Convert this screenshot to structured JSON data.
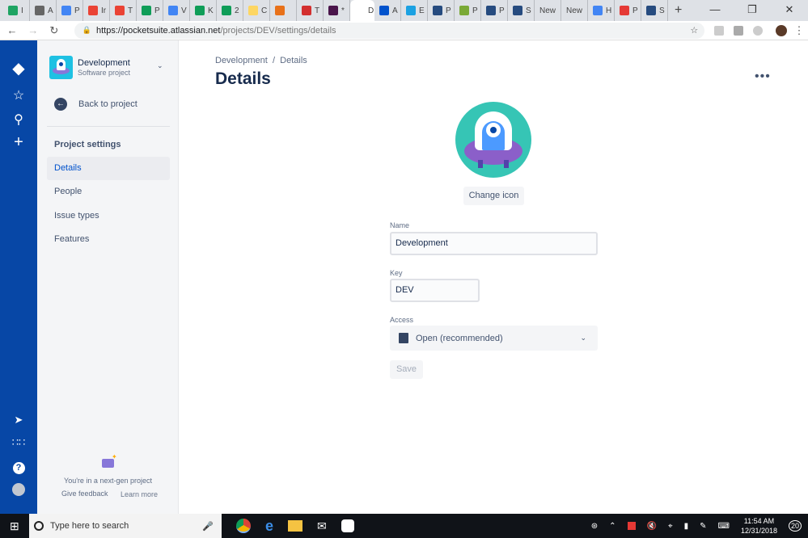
{
  "browser": {
    "tabs": [
      {
        "label": "I",
        "color": "#1fa463"
      },
      {
        "label": "A",
        "color": "#666"
      },
      {
        "label": "P",
        "color": "#4285f4"
      },
      {
        "label": "Ir",
        "color": "#ea4335"
      },
      {
        "label": "T",
        "color": "#ea4335"
      },
      {
        "label": "P",
        "color": "#0f9d58"
      },
      {
        "label": "V",
        "color": "#4285f4"
      },
      {
        "label": "K",
        "color": "#0f9d58"
      },
      {
        "label": "2",
        "color": "#0f9d58"
      },
      {
        "label": "C",
        "color": "#fdd663"
      },
      {
        "label": "",
        "color": "#e8711a"
      },
      {
        "label": "T",
        "color": "#d32f2f"
      },
      {
        "label": "*",
        "color": "#4a154b"
      },
      {
        "label": "D",
        "color": "#fff",
        "active": true
      },
      {
        "label": "A",
        "color": "#0052cc"
      },
      {
        "label": "E",
        "color": "#1ba1e2"
      },
      {
        "label": "P",
        "color": "#264b7f"
      },
      {
        "label": "P",
        "color": "#7aa936"
      },
      {
        "label": "P",
        "color": "#264b7f"
      },
      {
        "label": "S",
        "color": "#264b7f"
      },
      {
        "label": "New",
        "color": ""
      },
      {
        "label": "New",
        "color": ""
      },
      {
        "label": "H",
        "color": "#4285f4"
      },
      {
        "label": "P",
        "color": "#e53935"
      },
      {
        "label": "S",
        "color": "#264b7f"
      }
    ],
    "new_tab": "+",
    "url_host": "https://pocketsuite.atlassian.net",
    "url_path": "/projects/DEV/settings/details"
  },
  "sidebar": {
    "project_name": "Development",
    "project_type": "Software project",
    "back": "Back to project",
    "section": "Project settings",
    "items": [
      {
        "label": "Details",
        "selected": true
      },
      {
        "label": "People"
      },
      {
        "label": "Issue types"
      },
      {
        "label": "Features"
      }
    ],
    "footer": "You're in a next-gen project",
    "feedback": "Give feedback",
    "learn": "Learn more"
  },
  "main": {
    "breadcrumb_project": "Development",
    "breadcrumb_sep": "/",
    "breadcrumb_page": "Details",
    "title": "Details",
    "change_icon": "Change icon",
    "name_label": "Name",
    "name_value": "Development",
    "key_label": "Key",
    "key_value": "DEV",
    "access_label": "Access",
    "access_value": "Open (recommended)",
    "save": "Save"
  },
  "taskbar": {
    "search_placeholder": "Type here to search",
    "time": "11:54 AM",
    "date": "12/31/2018",
    "notifications": "20"
  }
}
